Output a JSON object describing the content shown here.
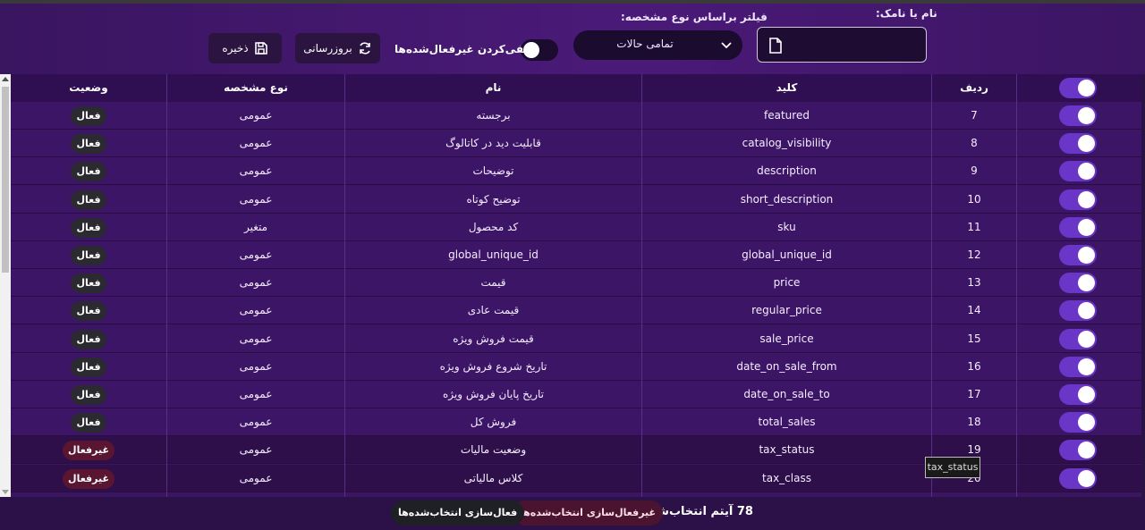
{
  "toolbar": {
    "name_label": "نام یا نامک:",
    "name_value": "",
    "filter_label": "فیلتر براساس نوع مشخصه:",
    "filter_value": "تمامی حالات",
    "hide_inactive_label": "مخفی‌کردن غیرفعال‌شده‌ها",
    "hide_inactive_on": false,
    "refresh_label": "بروزرسانی",
    "save_label": "ذخیره"
  },
  "table": {
    "headers": {
      "status": "وضعیت",
      "type": "نوع مشخصه",
      "name": "نام",
      "key": "کلید",
      "num": "ردیف"
    },
    "rows": [
      {
        "num": "7",
        "key": "featured",
        "name": "برجسته",
        "type": "عمومی",
        "status": "فعال",
        "active": true
      },
      {
        "num": "8",
        "key": "catalog_visibility",
        "name": "قابلیت دید در کاتالوگ",
        "type": "عمومی",
        "status": "فعال",
        "active": true
      },
      {
        "num": "9",
        "key": "description",
        "name": "توضیحات",
        "type": "عمومی",
        "status": "فعال",
        "active": true
      },
      {
        "num": "10",
        "key": "short_description",
        "name": "توضیح کوتاه",
        "type": "عمومی",
        "status": "فعال",
        "active": true
      },
      {
        "num": "11",
        "key": "sku",
        "name": "کد محصول",
        "type": "متغیر",
        "status": "فعال",
        "active": true
      },
      {
        "num": "12",
        "key": "global_unique_id",
        "name": "global_unique_id",
        "type": "عمومی",
        "status": "فعال",
        "active": true
      },
      {
        "num": "13",
        "key": "price",
        "name": "قیمت",
        "type": "عمومی",
        "status": "فعال",
        "active": true
      },
      {
        "num": "14",
        "key": "regular_price",
        "name": "قیمت عادی",
        "type": "عمومی",
        "status": "فعال",
        "active": true
      },
      {
        "num": "15",
        "key": "sale_price",
        "name": "قیمت فروش ویژه",
        "type": "عمومی",
        "status": "فعال",
        "active": true
      },
      {
        "num": "16",
        "key": "date_on_sale_from",
        "name": "تاریخ شروع فروش ویژه",
        "type": "عمومی",
        "status": "فعال",
        "active": true
      },
      {
        "num": "17",
        "key": "date_on_sale_to",
        "name": "تاریخ پایان فروش ویژه",
        "type": "عمومی",
        "status": "فعال",
        "active": true
      },
      {
        "num": "18",
        "key": "total_sales",
        "name": "فروش کل",
        "type": "عمومی",
        "status": "فعال",
        "active": true
      },
      {
        "num": "19",
        "key": "tax_status",
        "name": "وضعیت مالیات",
        "type": "عمومی",
        "status": "غیرفعال",
        "active": false
      },
      {
        "num": "20",
        "key": "tax_class",
        "name": "کلاس مالیاتی",
        "type": "عمومی",
        "status": "غیرفعال",
        "active": false
      }
    ]
  },
  "tooltip": "tax_status",
  "footer": {
    "selected_text": "78 آیتم انتخاب‌شده",
    "disable_selected": "غیرفعال‌سازی انتخاب‌شده‌ها",
    "enable_selected": "فعال‌سازی انتخاب‌شده‌ها"
  },
  "colors": {
    "accent": "#6a36c8",
    "background": "#2a1245",
    "inactive_badge": "#5a1630"
  }
}
